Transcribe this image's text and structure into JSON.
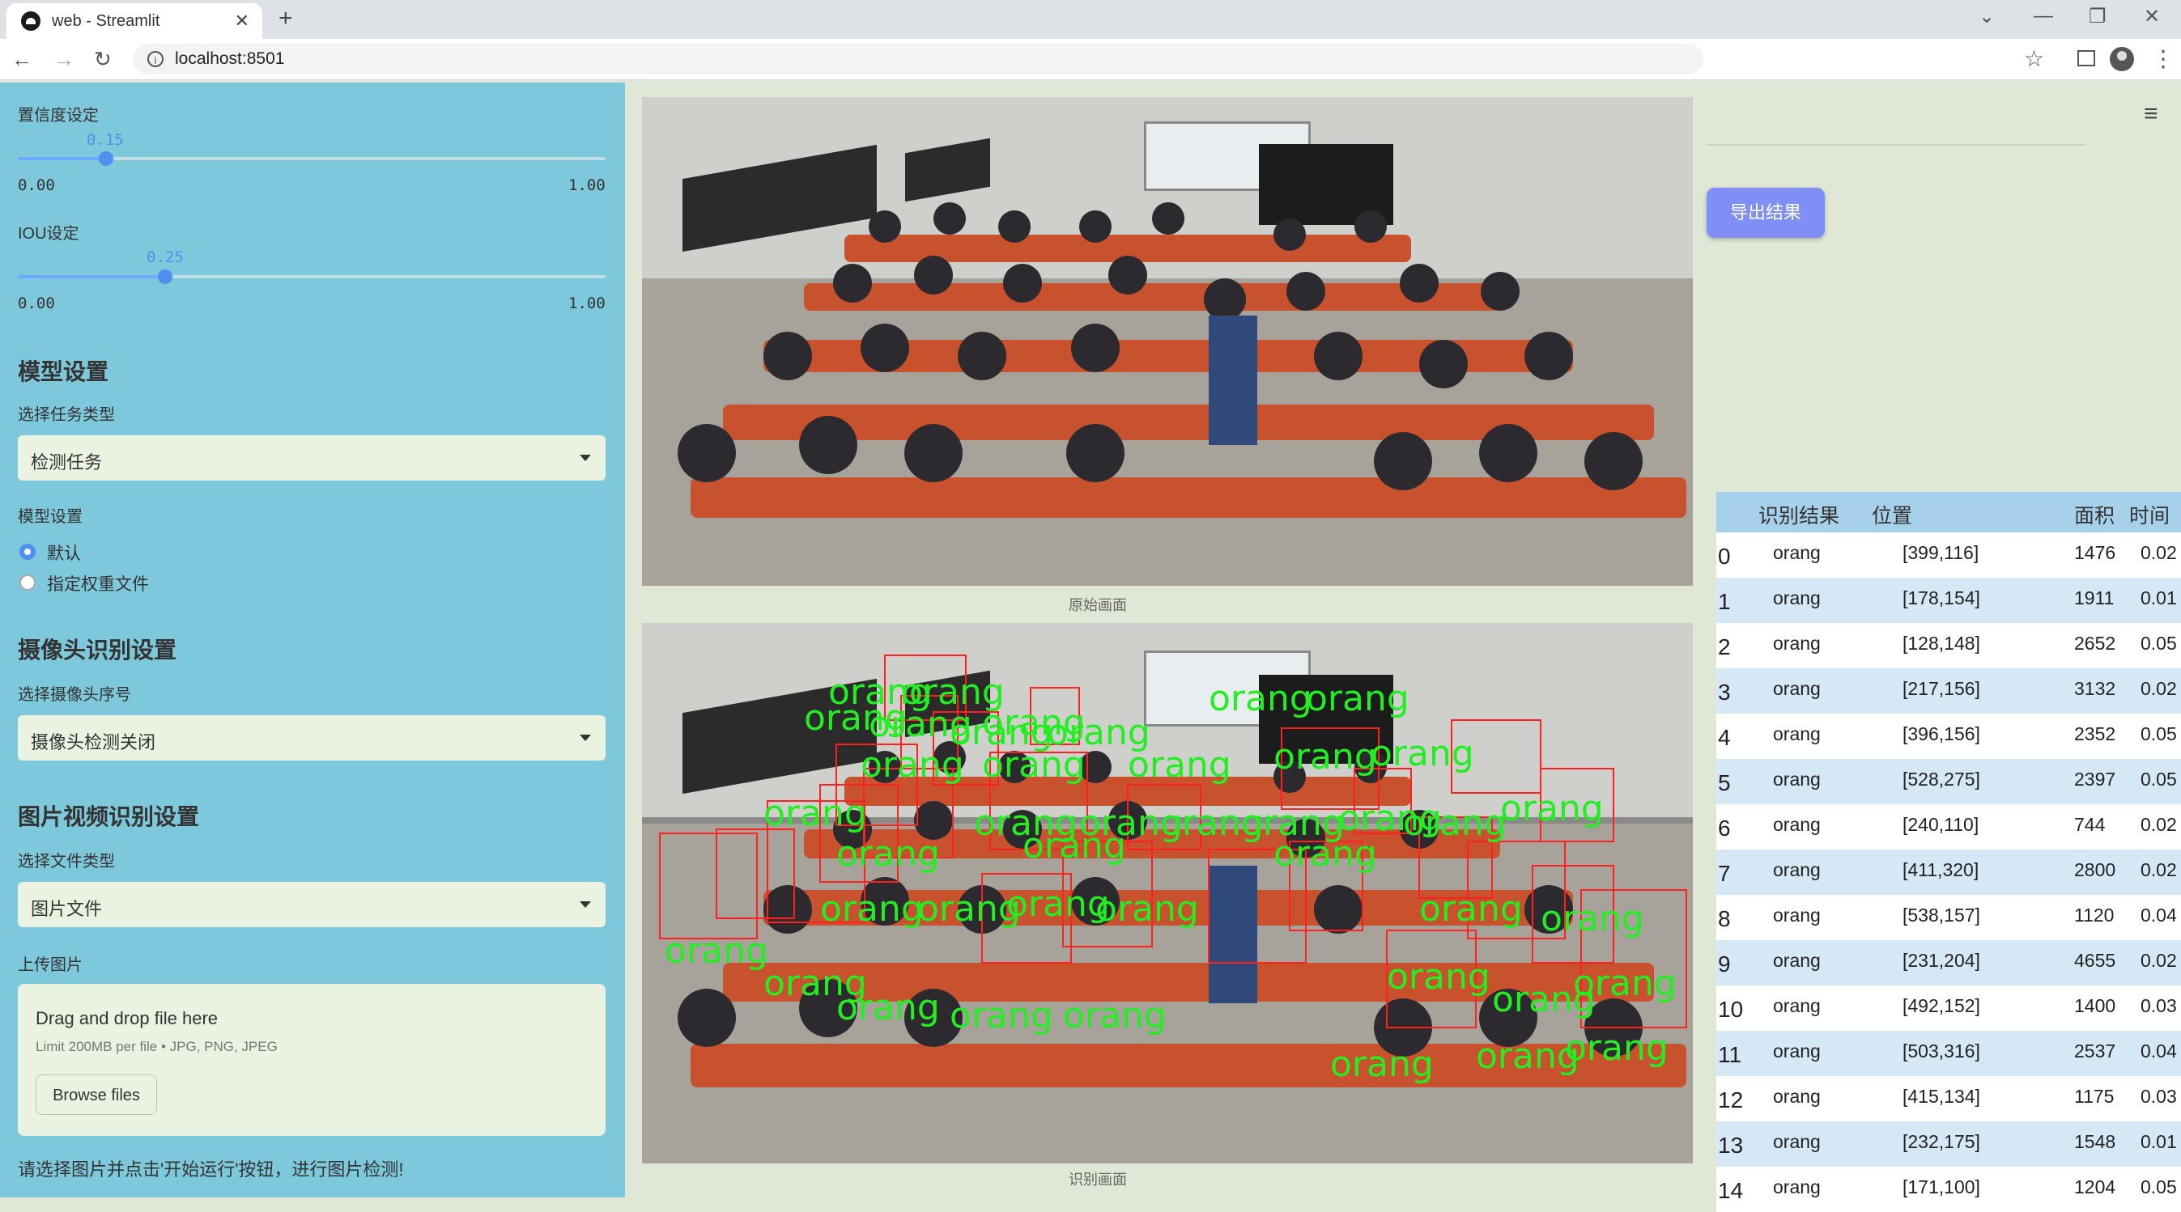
{
  "browser": {
    "tab_title": "web - Streamlit",
    "url": "localhost:8501"
  },
  "sidebar": {
    "confidence": {
      "label": "置信度设定",
      "value": "0.15",
      "min": "0.00",
      "max": "1.00",
      "fraction": 0.15
    },
    "iou": {
      "label": "IOU设定",
      "value": "0.25",
      "min": "0.00",
      "max": "1.00",
      "fraction": 0.25
    },
    "model_section": "模型设置",
    "task_label": "选择任务类型",
    "task_value": "检测任务",
    "model_label": "模型设置",
    "model_options": [
      "默认",
      "指定权重文件"
    ],
    "camera_section": "摄像头识别设置",
    "camera_label": "选择摄像头序号",
    "camera_value": "摄像头检测关闭",
    "media_section": "图片视频识别设置",
    "file_type_label": "选择文件类型",
    "file_type_value": "图片文件",
    "upload_label": "上传图片",
    "upload_title": "Drag and drop file here",
    "upload_limit": "Limit 200MB per file • JPG, PNG, JPEG",
    "browse_label": "Browse files",
    "footer": "请选择图片并点击'开始运行'按钮，进行图片检测!"
  },
  "main": {
    "original_caption": "原始画面",
    "result_caption": "识别画面",
    "export_label": "导出结果",
    "detection_label": "orang"
  },
  "table": {
    "headers": [
      "识别结果",
      "位置",
      "面积",
      "时间"
    ],
    "rows": [
      [
        "0",
        "orang",
        "[399,116]",
        "1476",
        "0.02"
      ],
      [
        "1",
        "orang",
        "[178,154]",
        "1911",
        "0.01"
      ],
      [
        "2",
        "orang",
        "[128,148]",
        "2652",
        "0.05"
      ],
      [
        "3",
        "orang",
        "[217,156]",
        "3132",
        "0.02"
      ],
      [
        "4",
        "orang",
        "[396,156]",
        "2352",
        "0.05"
      ],
      [
        "5",
        "orang",
        "[528,275]",
        "2397",
        "0.05"
      ],
      [
        "6",
        "orang",
        "[240,110]",
        "744",
        "0.02"
      ],
      [
        "7",
        "orang",
        "[411,320]",
        "2800",
        "0.02"
      ],
      [
        "8",
        "orang",
        "[538,157]",
        "1120",
        "0.04"
      ],
      [
        "9",
        "orang",
        "[231,204]",
        "4655",
        "0.02"
      ],
      [
        "10",
        "orang",
        "[492,152]",
        "1400",
        "0.03"
      ],
      [
        "11",
        "orang",
        "[503,316]",
        "2537",
        "0.04"
      ],
      [
        "12",
        "orang",
        "[415,134]",
        "1175",
        "0.03"
      ],
      [
        "13",
        "orang",
        "[232,175]",
        "1548",
        "0.01"
      ],
      [
        "14",
        "orang",
        "[171,100]",
        "1204",
        "0.05"
      ]
    ]
  }
}
